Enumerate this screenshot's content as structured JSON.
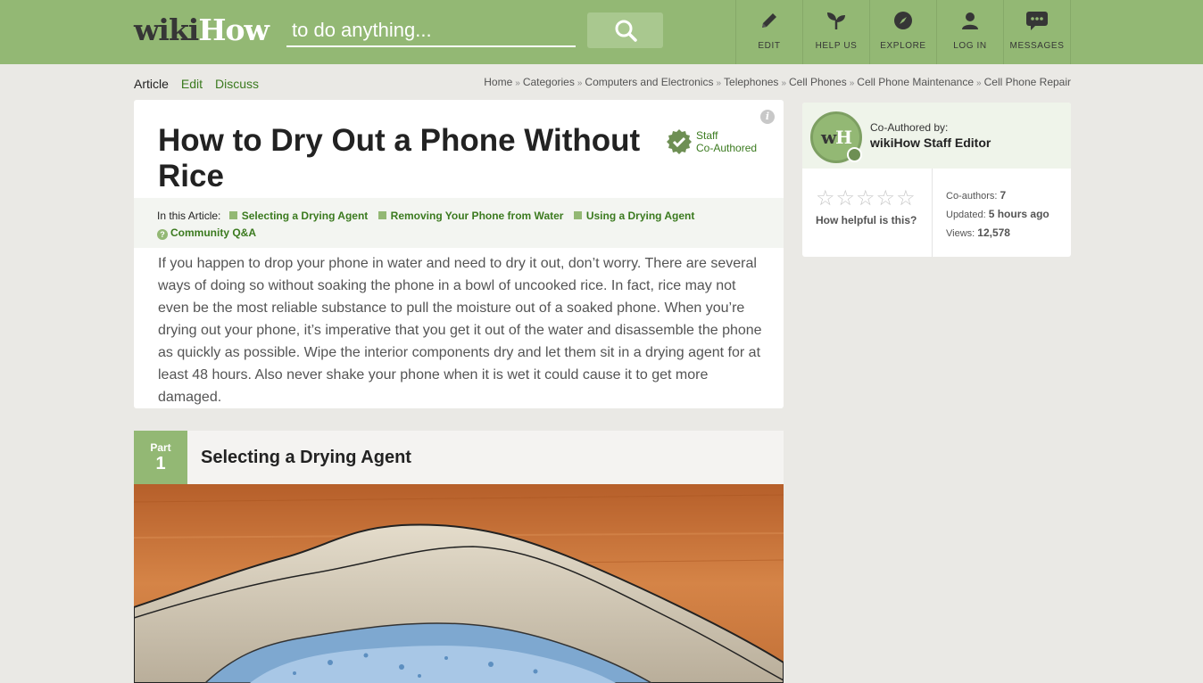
{
  "header": {
    "logo_wiki": "wiki",
    "logo_how": "How",
    "search_placeholder": "to do anything...",
    "nav": [
      {
        "label": "EDIT",
        "icon": "pencil-icon"
      },
      {
        "label": "HELP US",
        "icon": "sprout-icon"
      },
      {
        "label": "EXPLORE",
        "icon": "compass-icon"
      },
      {
        "label": "LOG IN",
        "icon": "user-icon"
      },
      {
        "label": "MESSAGES",
        "icon": "chat-icon"
      }
    ]
  },
  "subnav": {
    "tabs": [
      "Article",
      "Edit",
      "Discuss"
    ],
    "breadcrumb": [
      "Home",
      "Categories",
      "Computers and Electronics",
      "Telephones",
      "Cell Phones",
      "Cell Phone Maintenance",
      "Cell Phone Repair"
    ],
    "separator": "»"
  },
  "article": {
    "title": "How to Dry Out a Phone Without Rice",
    "badge_line1": "Staff",
    "badge_line2": "Co-Authored",
    "info_glyph": "i",
    "toc_label": "In this Article:",
    "toc": [
      "Selecting a Drying Agent",
      "Removing Your Phone from Water",
      "Using a Drying Agent"
    ],
    "toc_qa_glyph": "?",
    "toc_qa": "Community Q&A",
    "intro": "If you happen to drop your phone in water and need to dry it out, don’t worry. There are several ways of doing so without soaking the phone in a bowl of uncooked rice. In fact, rice may not even be the most reliable substance to pull the moisture out of a soaked phone. When you’re drying out your phone, it’s imperative that you get it out of the water and disassemble the phone as quickly as possible. Wipe the interior components dry and let them sit in a drying agent for at least 48 hours. Also never shake your phone when it is wet it could cause it to get more damaged."
  },
  "part": {
    "word": "Part",
    "number": "1",
    "title": "Selecting a Drying Agent"
  },
  "sidebar": {
    "avatar_w": "w",
    "avatar_h": "H",
    "coauthored_label": "Co-Authored by:",
    "author": "wikiHow Staff Editor",
    "star_glyph": "☆",
    "helpful": "How helpful is this?",
    "coauthors_label": "Co-authors:",
    "coauthors": "7",
    "updated_label": "Updated:",
    "updated": "5 hours ago",
    "views_label": "Views:",
    "views": "12,578"
  },
  "colors": {
    "brand_green": "#93b874",
    "link_green": "#3b7a1f",
    "background": "#eae9e5"
  }
}
